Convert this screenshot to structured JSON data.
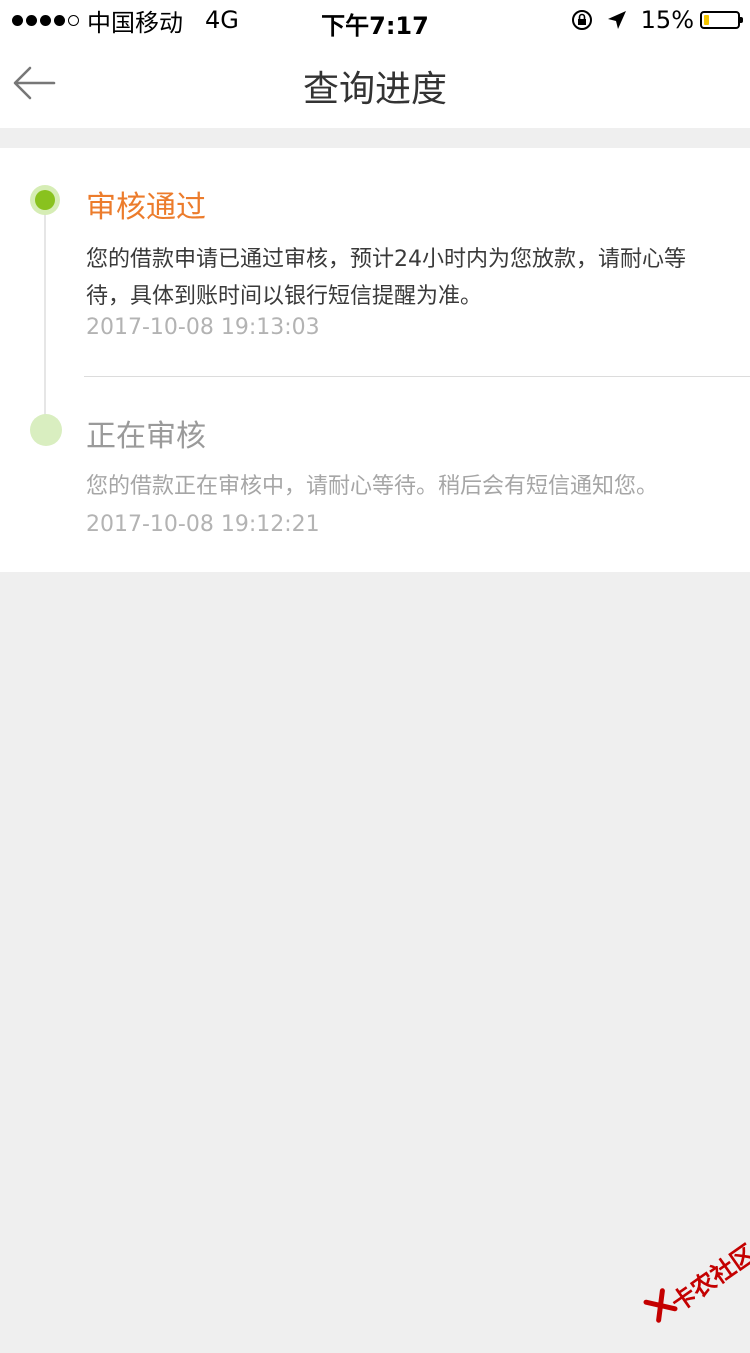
{
  "status_bar": {
    "carrier": "中国移动",
    "network": "4G",
    "time": "下午7:17",
    "battery_percent": "15%",
    "battery_level": 0.15,
    "battery_fill_color": "#f5c600"
  },
  "nav": {
    "title": "查询进度",
    "back_icon": "back-arrow-icon"
  },
  "steps": [
    {
      "title": "审核通过",
      "description": "您的借款申请已通过审核，预计24小时内为您放款，请耐心等待，具体到账时间以银行短信提醒为准。",
      "timestamp": "2017-10-08 19:13:03",
      "status": "current",
      "title_color": "#ec7c2c",
      "dot_color": "#89c21e"
    },
    {
      "title": "正在审核",
      "description": "您的借款正在审核中，请耐心等待。稍后会有短信通知您。",
      "timestamp": "2017-10-08 19:12:21",
      "status": "past",
      "title_color": "#9a9a9a",
      "dot_color": "#d9eec0"
    }
  ],
  "watermark": {
    "text": "卡农社区"
  }
}
